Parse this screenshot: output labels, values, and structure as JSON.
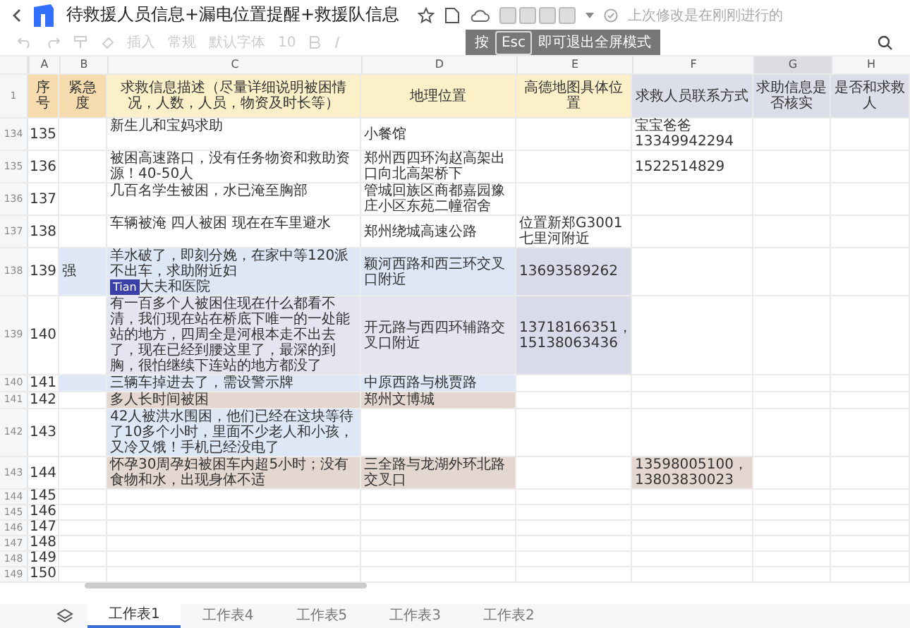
{
  "title": "待救援人员信息+漏电位置提醒+救援队信息",
  "last_saved": "上次修改是在刚刚进行的",
  "toolbar": [
    "插入",
    "常规",
    "默认字体",
    "10"
  ],
  "fullscreen_hint": {
    "before": "按",
    "key": "Esc",
    "after": "即可退出全屏模式"
  },
  "columns": [
    {
      "letter": "A",
      "selected": false
    },
    {
      "letter": "B",
      "selected": false
    },
    {
      "letter": "C",
      "selected": false
    },
    {
      "letter": "D",
      "selected": false
    },
    {
      "letter": "E",
      "selected": false
    },
    {
      "letter": "F",
      "selected": false
    },
    {
      "letter": "G",
      "selected": true
    },
    {
      "letter": "H",
      "selected": false
    }
  ],
  "header_row": {
    "number": "1",
    "cells": [
      {
        "text": "序号",
        "color": "#f6dcae"
      },
      {
        "text": "紧急度",
        "color": "#f6dcae"
      },
      {
        "text": "求救信息描述（尽量详细说明被困情况，人数，人员，物资及时长等）",
        "color": "#fcf0c8"
      },
      {
        "text": "地理位置",
        "color": "#fcf0c8"
      },
      {
        "text": "高德地图具体位置",
        "color": "#fcf0c8"
      },
      {
        "text": "求救人员联系方式",
        "color": "#dcdfea"
      },
      {
        "text": "求助信息是否核实",
        "color": "#dcdfea"
      },
      {
        "text": "是否和求救人",
        "color": "#dcdfea"
      }
    ]
  },
  "rows": [
    {
      "number": "134",
      "cells": [
        {
          "text": "135"
        },
        {},
        {
          "text": "新生儿和宝妈求助"
        },
        {
          "text": "小餐馆"
        },
        {},
        {
          "text": "宝宝爸爸13349942294"
        },
        {},
        {}
      ]
    },
    {
      "number": "135",
      "cells": [
        {
          "text": "136"
        },
        {},
        {
          "text": "被困高速路口，没有任务物资和救助资源！40-50人"
        },
        {
          "text": "郑州西四环沟赵高架出口向北高架桥下"
        },
        {},
        {
          "text": "1522514829"
        },
        {},
        {}
      ]
    },
    {
      "number": "136",
      "cells": [
        {
          "text": "137"
        },
        {},
        {
          "text": "几百名学生被困，水已淹至胸部"
        },
        {
          "text": "管城回族区商都嘉园豫庄小区东苑二幢宿舍"
        },
        {},
        {},
        {},
        {}
      ]
    },
    {
      "number": "137",
      "cells": [
        {
          "text": "138"
        },
        {},
        {
          "text": "车辆被淹 四人被困 现在在车里避水"
        },
        {
          "text": "郑州绕城高速公路"
        },
        {
          "text": "位置新郑G3001七里河附近"
        },
        {},
        {},
        {}
      ]
    },
    {
      "number": "138",
      "cells": [
        {
          "text": "139"
        },
        {
          "text": "强",
          "color": "#dde7f6"
        },
        {
          "text": "羊水破了，即刻分娩，在家中等120派不出车，求助附近妇",
          "cursor": "Tian",
          "text_after": "大夫和医院",
          "color": "#dde7f6"
        },
        {
          "text": "颖河西路和西三环交叉口附近",
          "color": "#dde7f6"
        },
        {
          "text": "13693589262",
          "color": "#d9dbea"
        },
        {},
        {},
        {}
      ]
    },
    {
      "number": "139",
      "cells": [
        {
          "text": "140"
        },
        {},
        {
          "text": "有一百多个人被困住现在什么都看不清，我们现在站在桥底下唯一的一处能站的地方，四周全是河根本走不出去了，现在已经到腰这里了，最深的到胸，很怕继续下连站的地方都没了",
          "color": "#e4e5f1"
        },
        {
          "text": "开元路与西四环辅路交叉口附近",
          "color": "#e4e5f1"
        },
        {
          "text": "13718166351，15138063436",
          "color": "#d9dbea"
        },
        {},
        {},
        {}
      ]
    },
    {
      "number": "140",
      "cells": [
        {
          "text": "141"
        },
        {
          "color": "#dde7f6"
        },
        {
          "text": "三辆车掉进去了，需设警示牌",
          "color": "#dde7f6"
        },
        {
          "text": "中原西路与桃贾路",
          "color": "#dde7f6"
        },
        {},
        {},
        {},
        {}
      ]
    },
    {
      "number": "141",
      "cells": [
        {
          "text": "142"
        },
        {},
        {
          "text": "多人长时间被困",
          "color": "#e3d7d0"
        },
        {
          "text": "郑州文博城",
          "color": "#e3d7d0"
        },
        {},
        {},
        {},
        {}
      ]
    },
    {
      "number": "142",
      "cells": [
        {
          "text": "143"
        },
        {},
        {
          "text": "42人被洪水围困，他们已经在这块等待了10多个小时，里面不少老人和小孩，又冷又饿！手机已经没电了",
          "color": "#dde7f6"
        },
        {},
        {},
        {},
        {},
        {}
      ]
    },
    {
      "number": "143",
      "cells": [
        {
          "text": "144"
        },
        {},
        {
          "text": "怀孕30周孕妇被困车内超5小时；没有食物和水，出现身体不适",
          "color": "#e3d7d0"
        },
        {
          "text": "三全路与龙湖外环北路交叉口",
          "color": "#e3d7d0"
        },
        {},
        {
          "text": "13598005100，13803830023",
          "color": "#e3d7d0"
        },
        {},
        {}
      ]
    },
    {
      "number": "144",
      "cells": [
        {
          "text": "145"
        },
        {},
        {},
        {},
        {},
        {},
        {},
        {}
      ]
    },
    {
      "number": "145",
      "cells": [
        {
          "text": "146"
        },
        {},
        {},
        {},
        {},
        {},
        {},
        {}
      ]
    },
    {
      "number": "146",
      "cells": [
        {
          "text": "147"
        },
        {},
        {},
        {},
        {},
        {},
        {},
        {}
      ]
    },
    {
      "number": "147",
      "cells": [
        {
          "text": "148"
        },
        {},
        {},
        {},
        {},
        {},
        {},
        {}
      ]
    },
    {
      "number": "148",
      "cells": [
        {
          "text": "149"
        },
        {},
        {},
        {},
        {},
        {},
        {},
        {}
      ]
    },
    {
      "number": "149",
      "cells": [
        {
          "text": "150"
        },
        {},
        {},
        {},
        {},
        {},
        {},
        {}
      ]
    }
  ],
  "sheets": [
    {
      "label": "工作表1",
      "selected": true
    },
    {
      "label": "工作表4",
      "selected": false
    },
    {
      "label": "工作表5",
      "selected": false
    },
    {
      "label": "工作表3",
      "selected": false
    },
    {
      "label": "工作表2",
      "selected": false
    }
  ]
}
